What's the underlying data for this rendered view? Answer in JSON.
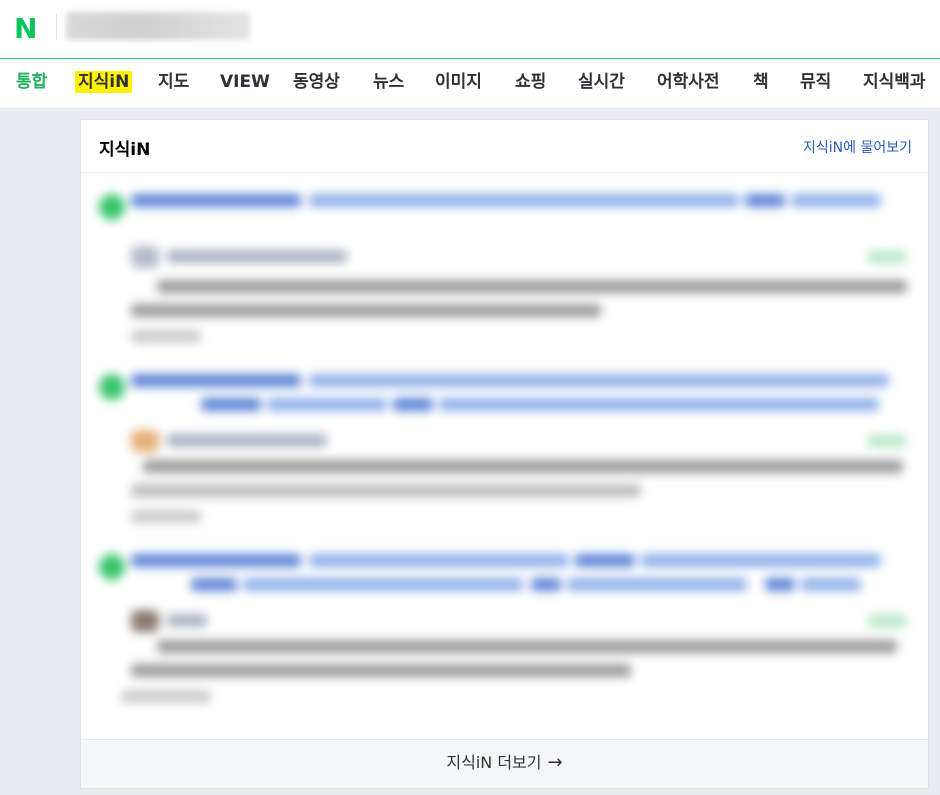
{
  "header": {
    "logo": "N",
    "search_value": ""
  },
  "tabs": [
    {
      "label": "통합",
      "state": "active"
    },
    {
      "label": "지식iN",
      "state": "highlighted"
    },
    {
      "label": "지도"
    },
    {
      "label": "VIEW"
    },
    {
      "label": "동영상"
    },
    {
      "label": "뉴스"
    },
    {
      "label": "이미지"
    },
    {
      "label": "쇼핑"
    },
    {
      "label": "실시간"
    },
    {
      "label": "어학사전"
    },
    {
      "label": "책"
    },
    {
      "label": "뮤직"
    },
    {
      "label": "지식백과"
    }
  ],
  "card": {
    "title": "지식iN",
    "ask_link": "지식iN에 물어보기",
    "more_label": "지식iN 더보기",
    "more_arrow": "→"
  },
  "colors": {
    "brand_green": "#03c75a",
    "active_tab": "#1eb15b",
    "highlight": "#fff200",
    "link_blue": "#2a5bbd"
  },
  "icons": {
    "logo": "naver-n-logo",
    "more": "arrow-right-icon"
  }
}
